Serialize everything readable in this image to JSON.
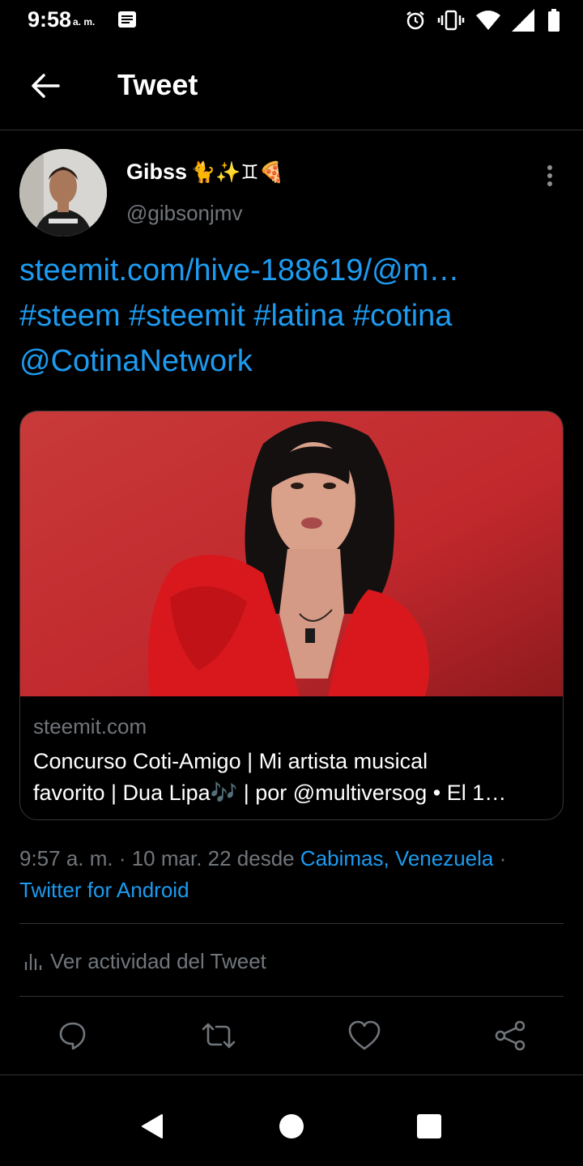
{
  "status_bar": {
    "time": "9:58",
    "ampm": "a. m."
  },
  "app_bar": {
    "title": "Tweet"
  },
  "author": {
    "name": "Gibss",
    "emojis": "🐈✨♊🍕",
    "handle": "@gibsonjmv"
  },
  "tweet": {
    "lines": [
      "steemit.com/hive-188619/@m…",
      " #steem #steemit #latina #cotina",
      "@CotinaNetwork"
    ]
  },
  "card": {
    "domain": "steemit.com",
    "title_line1": "Concurso Coti-Amigo | Mi artista musical",
    "title_line2": "favorito | Dua Lipa🎶 | por @multiversog • El 1…"
  },
  "meta": {
    "timestamp": "9:57 a. m. · 10 mar. 22 desde ",
    "location": "Cabimas, Venezuela",
    "sep": " ·",
    "client": "Twitter for Android"
  },
  "activity": {
    "label": "Ver actividad del Tweet"
  },
  "colors": {
    "accent": "#1d9bf0",
    "secondary_text": "#71767b",
    "background": "#000000",
    "card_bg": "#c4252b"
  },
  "icons": [
    "back-arrow-icon",
    "more-vertical-icon",
    "reply-icon",
    "retweet-icon",
    "like-icon",
    "share-icon",
    "chart-icon",
    "nav-back-icon",
    "nav-home-icon",
    "nav-recents-icon"
  ]
}
